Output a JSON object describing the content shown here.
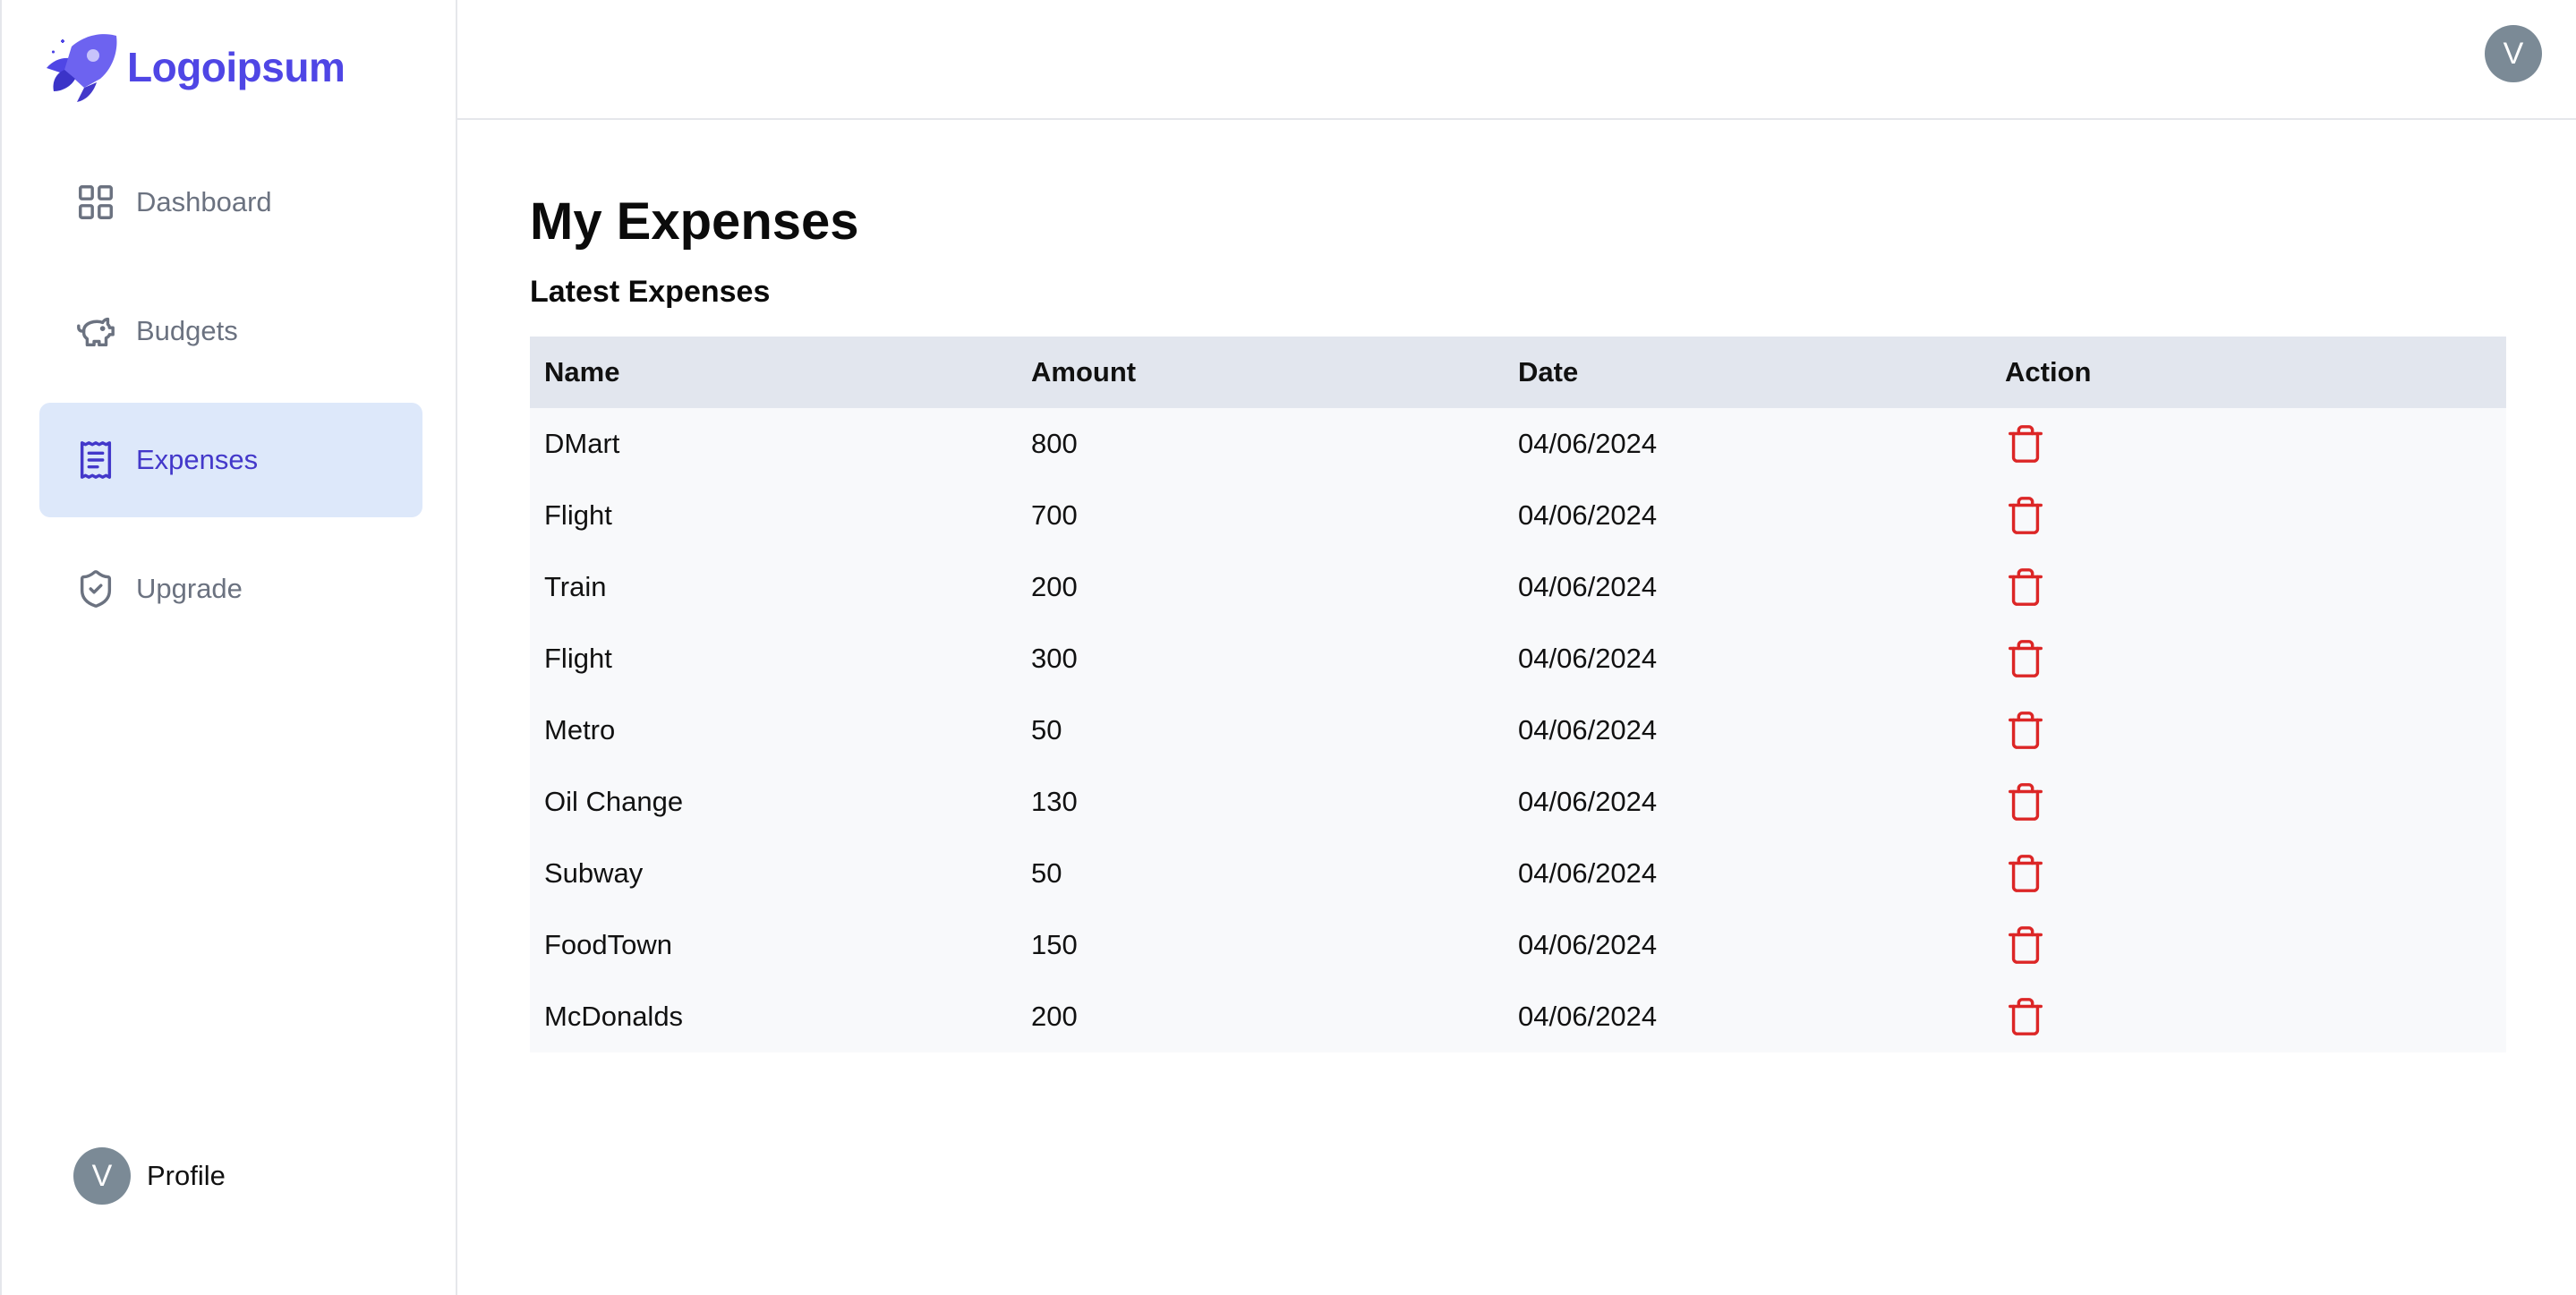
{
  "brand": {
    "name": "Logoipsum",
    "color": "#4f46e5"
  },
  "sidebar": {
    "items": [
      {
        "label": "Dashboard",
        "icon": "layout-grid-icon",
        "active": false
      },
      {
        "label": "Budgets",
        "icon": "piggy-bank-icon",
        "active": false
      },
      {
        "label": "Expenses",
        "icon": "receipt-icon",
        "active": true
      },
      {
        "label": "Upgrade",
        "icon": "shield-check-icon",
        "active": false
      }
    ],
    "profile": {
      "initial": "V",
      "label": "Profile"
    }
  },
  "header": {
    "avatar_initial": "V"
  },
  "main": {
    "title": "My Expenses",
    "section_title": "Latest Expenses",
    "table": {
      "headers": [
        "Name",
        "Amount",
        "Date",
        "Action"
      ],
      "rows": [
        {
          "name": "DMart",
          "amount": "800",
          "date": "04/06/2024"
        },
        {
          "name": "Flight",
          "amount": "700",
          "date": "04/06/2024"
        },
        {
          "name": "Train",
          "amount": "200",
          "date": "04/06/2024"
        },
        {
          "name": "Flight",
          "amount": "300",
          "date": "04/06/2024"
        },
        {
          "name": "Metro",
          "amount": "50",
          "date": "04/06/2024"
        },
        {
          "name": "Oil Change",
          "amount": "130",
          "date": "04/06/2024"
        },
        {
          "name": "Subway",
          "amount": "50",
          "date": "04/06/2024"
        },
        {
          "name": "FoodTown",
          "amount": "150",
          "date": "04/06/2024"
        },
        {
          "name": "McDonalds",
          "amount": "200",
          "date": "04/06/2024"
        }
      ],
      "action_icon": "trash-icon",
      "action_color": "#dc2626"
    }
  },
  "colors": {
    "accent": "#4f46e5",
    "active_bg": "#dde8fa",
    "header_row_bg": "#e2e6ee",
    "row_bg": "#f8f9fb",
    "avatar_bg": "#7b8a96"
  }
}
